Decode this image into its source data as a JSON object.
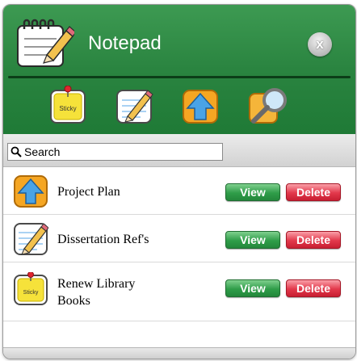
{
  "app": {
    "title": "Notepad",
    "icon": "notepad-pencil-icon",
    "close_label": "x"
  },
  "toolbar": [
    {
      "name": "sticky-note-icon",
      "label": "Sticky"
    },
    {
      "name": "note-pencil-icon"
    },
    {
      "name": "upload-arrow-icon"
    },
    {
      "name": "magnifier-icon"
    }
  ],
  "search": {
    "placeholder": "Search",
    "value": ""
  },
  "notes": [
    {
      "title": "Project Plan",
      "icon": "upload-arrow-icon",
      "view_label": "View",
      "delete_label": "Delete"
    },
    {
      "title": "Dissertation Ref's",
      "icon": "note-pencil-icon",
      "view_label": "View",
      "delete_label": "Delete"
    },
    {
      "title": "Renew Library Books",
      "icon": "sticky-note-icon",
      "icon_label": "Sticky",
      "view_label": "View",
      "delete_label": "Delete"
    }
  ],
  "colors": {
    "header_green": "#2a8440",
    "view_green": "#2f9d49",
    "delete_red": "#e2384b"
  }
}
